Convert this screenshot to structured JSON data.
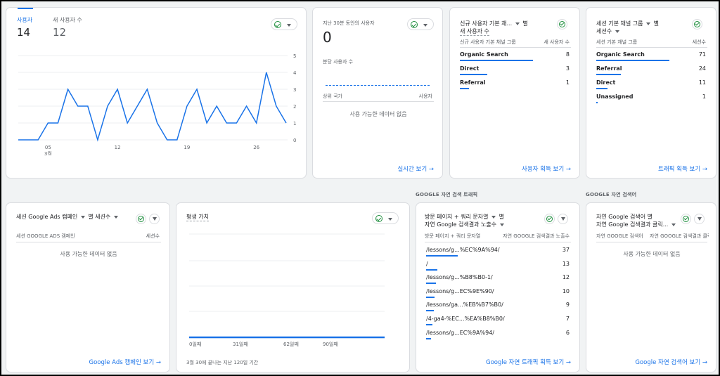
{
  "users_card": {
    "tab_users_label": "사용자",
    "tab_users_value": "14",
    "tab_new_users_label": "새 사용자 수",
    "tab_new_users_value": "12",
    "y_ticks": [
      "5",
      "4",
      "3",
      "2",
      "1",
      "0"
    ],
    "x_ticks": [
      "05",
      "12",
      "19",
      "26"
    ],
    "x_sub": "3월"
  },
  "chart_data": {
    "type": "line",
    "x": [
      "03-02",
      "03-03",
      "03-04",
      "03-05",
      "03-06",
      "03-07",
      "03-08",
      "03-09",
      "03-10",
      "03-11",
      "03-12",
      "03-13",
      "03-14",
      "03-15",
      "03-16",
      "03-17",
      "03-18",
      "03-19",
      "03-20",
      "03-21",
      "03-22",
      "03-23",
      "03-24",
      "03-25",
      "03-26",
      "03-27",
      "03-28",
      "03-29",
      "03-30"
    ],
    "series": [
      {
        "values": [
          0,
          0,
          0,
          1,
          1,
          3,
          2,
          2,
          0,
          2,
          3,
          1,
          2,
          3,
          1,
          0,
          0,
          2,
          3,
          1,
          2,
          1,
          1,
          2,
          1,
          4,
          2,
          1
        ]
      }
    ],
    "ylim": [
      0,
      5
    ],
    "x_tick_labels": [
      "05",
      "12",
      "19",
      "26"
    ],
    "x_sub_label": "3월",
    "grid": true,
    "color": "#1a73e8"
  },
  "realtime_card": {
    "title": "지난 30분 동안의 사용자",
    "value": "0",
    "per_minute_label": "분당 사용자 수",
    "col_country": "상위 국가",
    "col_users": "사용자",
    "empty": "사용 가능한 데이터 없음",
    "link": "실시간 보기"
  },
  "new_users_card": {
    "title_line1": "신규 사용자 기본 채...",
    "title_suffix": "별",
    "title_line2": "새 사용자 수",
    "col_dim": "신규 사용자 기본 채널 그룹",
    "col_metric": "새 사용자 수",
    "rows": [
      {
        "label": "Organic Search",
        "value": "8",
        "frac": 1.0
      },
      {
        "label": "Direct",
        "value": "3",
        "frac": 0.375
      },
      {
        "label": "Referral",
        "value": "1",
        "frac": 0.125
      }
    ],
    "link": "사용자 획득 보기"
  },
  "sessions_card": {
    "title_line1": "세션 기본 채널 그룹",
    "title_suffix": "별",
    "title_line2": "세션수",
    "col_dim": "세션 기본 채널 그룹",
    "col_metric": "세션수",
    "rows": [
      {
        "label": "Organic Search",
        "value": "71",
        "frac": 1.0
      },
      {
        "label": "Referral",
        "value": "24",
        "frac": 0.34
      },
      {
        "label": "Direct",
        "value": "11",
        "frac": 0.155
      },
      {
        "label": "Unassigned",
        "value": "1",
        "frac": 0.014
      }
    ],
    "link": "트래픽 획득 보기"
  },
  "ads_card": {
    "title_a": "세션 Google Ads 캠페인",
    "title_b": "별 세션수",
    "col_dim": "세션 GOOGLE ADS 캠페인",
    "col_metric": "세션수",
    "empty": "사용 가능한 데이터 없음",
    "link": "Google Ads 캠페인 보기"
  },
  "ltv_card": {
    "title": "평생 가치",
    "x_ticks": [
      "0일째",
      "31일째",
      "62일째",
      "90일째"
    ],
    "footer": "3월 30에 끝나는 지난 120일 기간"
  },
  "organic_traffic": {
    "section_label": "GOOGLE 자연 검색 트래픽",
    "title_line1": "방문 페이지 + 쿼리 문자열",
    "title_suffix": "별",
    "title_line2": "자연 Google 검색결과 노출수",
    "col_dim": "방문 페이지 + 쿼리 문자열",
    "col_metric": "자연 GOOGLE 검색결과 노출수",
    "rows": [
      {
        "label": "/lessons/g...%EC%9A%94/",
        "value": "37",
        "frac": 1.0
      },
      {
        "label": "/",
        "value": "13",
        "frac": 0.35
      },
      {
        "label": "/lessons/g...%B8%B0-1/",
        "value": "12",
        "frac": 0.32
      },
      {
        "label": "/lessons/g...EC%9E%90/",
        "value": "10",
        "frac": 0.27
      },
      {
        "label": "/lessons/ga...%EB%B7%B0/",
        "value": "9",
        "frac": 0.24
      },
      {
        "label": "/4-ga4-%EC...%EA%B8%B0/",
        "value": "7",
        "frac": 0.19
      },
      {
        "label": "/lessons/g...EC%9A%94/",
        "value": "6",
        "frac": 0.16
      }
    ],
    "link": "Google 자연 트래픽 획득 보기"
  },
  "organic_query": {
    "section_label": "GOOGLE 자연 검색어",
    "title_line1": "자연 Google 검색어",
    "title_suffix": "별",
    "title_line2": "자연 Google 검색결과 클릭...",
    "col_dim": "자연 GOOGLE 검색어",
    "col_metric": "자연 GOOGLE 검색결과 클릭",
    "empty": "사용 가능한 데이터 없음",
    "link": "Google 자연 검색어 보기"
  }
}
